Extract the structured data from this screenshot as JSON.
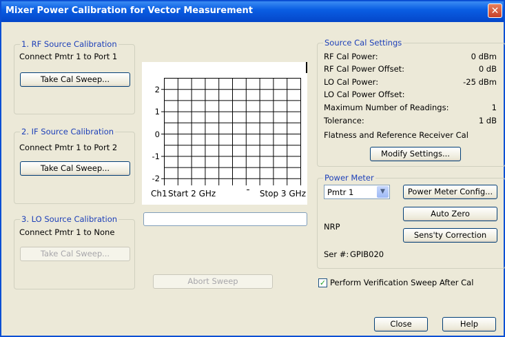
{
  "window": {
    "title": "Mixer Power Calibration for Vector Measurement",
    "close_glyph": "✕"
  },
  "rf": {
    "legend": "1. RF Source Calibration",
    "connect": "Connect Pmtr 1 to Port 1",
    "button": "Take Cal Sweep..."
  },
  "if_cal": {
    "legend": "2. IF Source Calibration",
    "connect": "Connect Pmtr 1 to Port 2",
    "button": "Take Cal Sweep..."
  },
  "lo": {
    "legend": "3. LO Source Calibration",
    "connect": "Connect Pmtr 1 to None",
    "button": "Take Cal Sweep..."
  },
  "plot": {
    "y_ticks": [
      "2",
      "1",
      "0",
      "-1",
      "-2"
    ],
    "channel": "Ch1",
    "start": "Start 2 GHz",
    "stop": "Stop 3 GHz"
  },
  "abort_button": "Abort Sweep",
  "source_cal": {
    "legend": "Source Cal Settings",
    "rows": [
      {
        "label": "RF Cal Power:",
        "value": "0 dBm"
      },
      {
        "label": "RF Cal Power Offset:",
        "value": "0 dB"
      },
      {
        "label": "LO Cal Power:",
        "value": "-25 dBm"
      },
      {
        "label": "LO Cal Power Offset:",
        "value": ""
      },
      {
        "label": "Maximum Number of Readings:",
        "value": "1"
      },
      {
        "label": "Tolerance:",
        "value": "1 dB"
      }
    ],
    "flatness": "Flatness and Reference Receiver Cal",
    "modify_button": "Modify Settings..."
  },
  "power_meter": {
    "legend": "Power Meter",
    "selected": "Pmtr 1",
    "config_button": "Power Meter Config...",
    "autozero_button": "Auto Zero",
    "model": "NRP",
    "sensitivity_button": "Sens'ty Correction",
    "serial_label": "Ser #:",
    "serial_value": "GPIB020"
  },
  "verify": {
    "label": "Perform Verification Sweep After Cal",
    "checked": true
  },
  "footer": {
    "close_button": "Close",
    "help_button": "Help"
  }
}
